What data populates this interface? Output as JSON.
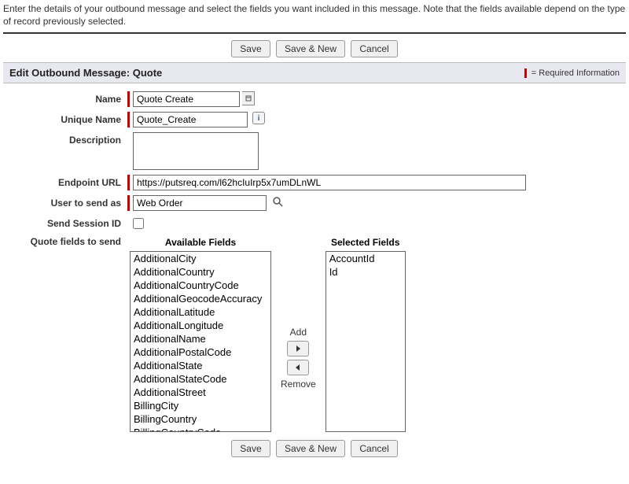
{
  "intro_text": "Enter the details of your outbound message and select the fields you want included in this message. Note that the fields available depend on the type of record previously selected.",
  "buttons": {
    "save": "Save",
    "save_new": "Save & New",
    "cancel": "Cancel"
  },
  "section": {
    "title": "Edit Outbound Message: Quote",
    "required_text": "= Required Information"
  },
  "form": {
    "name": {
      "label": "Name",
      "value": "Quote Create"
    },
    "unique_name": {
      "label": "Unique Name",
      "value": "Quote_Create"
    },
    "description": {
      "label": "Description",
      "value": ""
    },
    "endpoint_url": {
      "label": "Endpoint URL",
      "value": "https://putsreq.com/l62hcIuIrp5x7umDLnWL"
    },
    "user_send_as": {
      "label": "User to send as",
      "value": "Web Order"
    },
    "send_session": {
      "label": "Send Session ID"
    },
    "fields_to_send": {
      "label": "Quote fields to send"
    }
  },
  "dual_list": {
    "available_title": "Available Fields",
    "selected_title": "Selected Fields",
    "add_label": "Add",
    "remove_label": "Remove",
    "available": [
      "AdditionalCity",
      "AdditionalCountry",
      "AdditionalCountryCode",
      "AdditionalGeocodeAccuracy",
      "AdditionalLatitude",
      "AdditionalLongitude",
      "AdditionalName",
      "AdditionalPostalCode",
      "AdditionalState",
      "AdditionalStateCode",
      "AdditionalStreet",
      "BillingCity",
      "BillingCountry",
      "BillingCountryCode"
    ],
    "selected": [
      "AccountId",
      "Id"
    ]
  }
}
